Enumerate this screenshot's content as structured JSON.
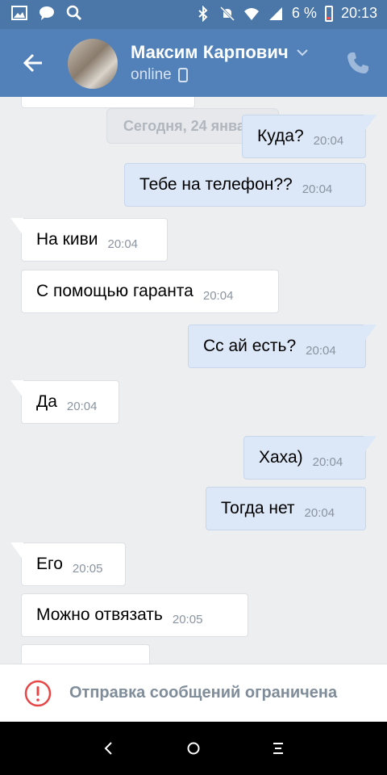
{
  "statusbar": {
    "battery": "6 %",
    "time": "20:13",
    "icons_left": [
      "image-icon",
      "message-icon",
      "search-icon"
    ],
    "icons_right": [
      "bluetooth-icon",
      "mute-icon",
      "wifi-icon",
      "signal-icon",
      "battery-icon"
    ]
  },
  "header": {
    "name": "Максим Карпович",
    "status": "online",
    "icons": [
      "back-arrow-icon",
      "chevron-down-icon",
      "mobile-icon",
      "phone-icon"
    ]
  },
  "chat": {
    "date_label": "Сегодня, 24 января",
    "messages": [
      {
        "dir": "out",
        "text": "Куда?",
        "time": "20:04"
      },
      {
        "dir": "out",
        "text": "Тебе на телефон??",
        "time": "20:04"
      },
      {
        "dir": "in",
        "text": "На киви",
        "time": "20:04"
      },
      {
        "dir": "in",
        "text": "С помощью гаранта",
        "time": "20:04"
      },
      {
        "dir": "out",
        "text": "Сс ай есть?",
        "time": "20:04"
      },
      {
        "dir": "in",
        "text": "Да",
        "time": "20:04"
      },
      {
        "dir": "out",
        "text": "Хаха)",
        "time": "20:04"
      },
      {
        "dir": "out",
        "text": "Тогда нет",
        "time": "20:04"
      },
      {
        "dir": "in",
        "text": "Его",
        "time": "20:05"
      },
      {
        "dir": "in",
        "text": "Можно отвязать",
        "time": "20:05"
      }
    ]
  },
  "restriction": {
    "text": "Отправка сообщений ограничена"
  },
  "colors": {
    "header": "#5181b8",
    "statusbar": "#4a76a8",
    "outgoing_bubble": "#dce7f7",
    "incoming_bubble": "#ffffff",
    "background": "#edeef0",
    "warning": "#e64646"
  }
}
